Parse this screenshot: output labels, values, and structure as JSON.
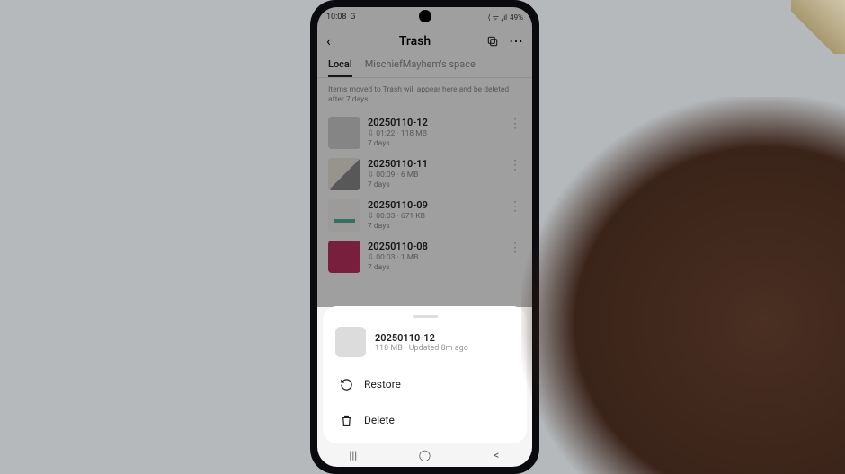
{
  "statusBar": {
    "time": "10:08",
    "carrier": "G",
    "battery": "49%",
    "icons": "⟨ ᯤ ₊ıl"
  },
  "header": {
    "title": "Trash"
  },
  "tabs": {
    "local": "Local",
    "space": "MischiefMayhem's space"
  },
  "hint": "Items moved to Trash will appear here and be deleted after 7 days.",
  "items": [
    {
      "title": "20250110-12",
      "meta": "⇩ 01:22 · 118 MB",
      "days": "7 days"
    },
    {
      "title": "20250110-11",
      "meta": "⇩ 00:09 · 6 MB",
      "days": "7 days"
    },
    {
      "title": "20250110-09",
      "meta": "⇩ 00:03 · 671 KB",
      "days": "7 days"
    },
    {
      "title": "20250110-08",
      "meta": "⇩ 00:03 · 1 MB",
      "days": "7 days"
    }
  ],
  "sheet": {
    "title": "20250110-12",
    "meta": "118 MB · Updated 8m ago",
    "restore": "Restore",
    "delete": "Delete"
  },
  "nav": {
    "recents": "|||",
    "home": "◯",
    "back": "<"
  }
}
